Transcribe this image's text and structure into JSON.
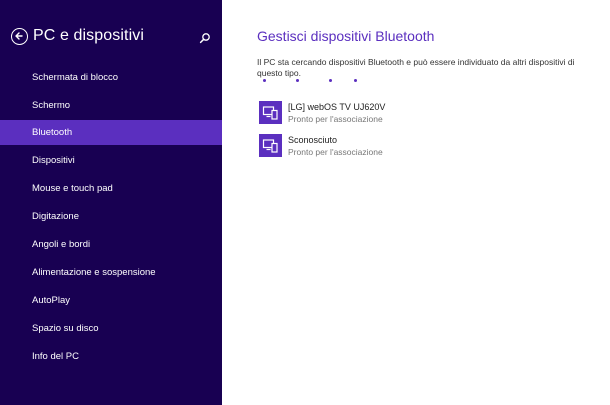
{
  "sidebar": {
    "title": "PC e dispositivi",
    "back_icon": "back-arrow-icon",
    "search_icon": "search-icon",
    "items": [
      {
        "label": "Schermata di blocco",
        "selected": false
      },
      {
        "label": "Schermo",
        "selected": false
      },
      {
        "label": "Bluetooth",
        "selected": true
      },
      {
        "label": "Dispositivi",
        "selected": false
      },
      {
        "label": "Mouse e touch pad",
        "selected": false
      },
      {
        "label": "Digitazione",
        "selected": false
      },
      {
        "label": "Angoli e bordi",
        "selected": false
      },
      {
        "label": "Alimentazione e sospensione",
        "selected": false
      },
      {
        "label": "AutoPlay",
        "selected": false
      },
      {
        "label": "Spazio su disco",
        "selected": false
      },
      {
        "label": "Info del PC",
        "selected": false
      }
    ]
  },
  "main": {
    "title": "Gestisci dispositivi Bluetooth",
    "description": "Il PC sta cercando dispositivi Bluetooth e può essere individuato da altri dispositivi di questo tipo.",
    "devices": [
      {
        "name": "[LG] webOS TV UJ620V",
        "status": "Pronto per l'associazione",
        "icon": "device-icon"
      },
      {
        "name": "Sconosciuto",
        "status": "Pronto per l'associazione",
        "icon": "device-icon"
      }
    ]
  },
  "colors": {
    "sidebar_background": "#180052",
    "accent": "#5b2fbf",
    "content_background": "#ffffff"
  }
}
